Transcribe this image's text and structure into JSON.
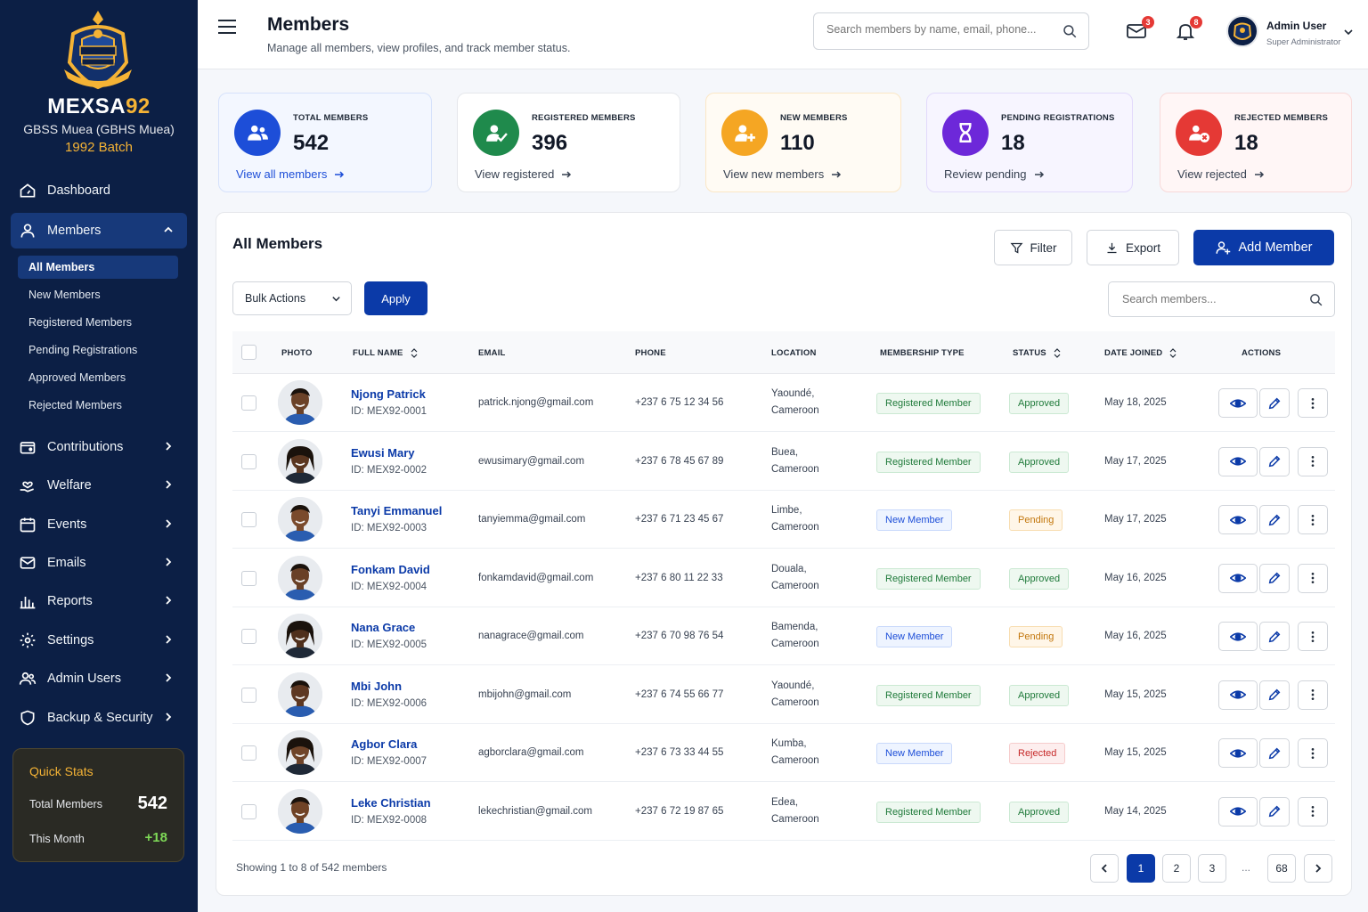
{
  "brand": {
    "name_a": "MEXSA",
    "name_b": "92",
    "school": "GBSS Muea (GBHS Muea)",
    "batch": "1992 Batch"
  },
  "nav": {
    "dashboard": "Dashboard",
    "members": "Members",
    "sub": [
      "All Members",
      "New Members",
      "Registered Members",
      "Pending Registrations",
      "Approved Members",
      "Rejected Members"
    ],
    "contributions": "Contributions",
    "welfare": "Welfare",
    "events": "Events",
    "emails": "Emails",
    "reports": "Reports",
    "settings": "Settings",
    "admin_users": "Admin Users",
    "backup": "Backup & Security"
  },
  "quick_stats": {
    "title": "Quick Stats",
    "total_label": "Total Members",
    "total_value": "542",
    "month_label": "This Month",
    "month_value": "+18"
  },
  "header": {
    "title": "Members",
    "subtitle": "Manage all members, view profiles, and track member status.",
    "search_placeholder": "Search members by name, email, phone...",
    "mail_badge": "3",
    "bell_badge": "8",
    "admin_name": "Admin User",
    "admin_role": "Super Administrator"
  },
  "stats": [
    {
      "label": "TOTAL MEMBERS",
      "value": "542",
      "link": "View all members",
      "color": "#1d4ed8",
      "bg": "#f3f7ff",
      "border": "#d6e2fb"
    },
    {
      "label": "REGISTERED MEMBERS",
      "value": "396",
      "link": "View registered",
      "color": "#1f8a4c",
      "bg": "#ffffff",
      "border": "#e5e7eb"
    },
    {
      "label": "NEW MEMBERS",
      "value": "110",
      "link": "View new members",
      "color": "#f5a623",
      "bg": "#fffbf4",
      "border": "#fbe7c6"
    },
    {
      "label": "PENDING REGISTRATIONS",
      "value": "18",
      "link": "Review pending",
      "color": "#6d28d9",
      "bg": "#f7f5ff",
      "border": "#e2dafb"
    },
    {
      "label": "REJECTED MEMBERS",
      "value": "18",
      "link": "View rejected",
      "color": "#e53935",
      "bg": "#fff6f6",
      "border": "#f8d9d9"
    }
  ],
  "panel": {
    "title": "All Members",
    "filter": "Filter",
    "export": "Export",
    "add": "Add Member",
    "bulk": "Bulk Actions",
    "apply": "Apply",
    "search_placeholder": "Search members..."
  },
  "columns": {
    "photo": "PHOTO",
    "name": "FULL NAME",
    "email": "EMAIL",
    "phone": "PHONE",
    "location": "LOCATION",
    "type": "MEMBERSHIP TYPE",
    "status": "STATUS",
    "date": "DATE JOINED",
    "actions": "ACTIONS"
  },
  "members": [
    {
      "name": "Njong Patrick",
      "id": "ID: MEX92-0001",
      "email": "patrick.njong@gmail.com",
      "phone": "+237 6 75 12 34 56",
      "city": "Yaoundé,",
      "country": "Cameroon",
      "type": "Registered Member",
      "status": "Approved",
      "date": "May 18, 2025",
      "gender": "m"
    },
    {
      "name": "Ewusi Mary",
      "id": "ID: MEX92-0002",
      "email": "ewusimary@gmail.com",
      "phone": "+237 6 78 45 67 89",
      "city": "Buea,",
      "country": "Cameroon",
      "type": "Registered Member",
      "status": "Approved",
      "date": "May 17, 2025",
      "gender": "f"
    },
    {
      "name": "Tanyi Emmanuel",
      "id": "ID: MEX92-0003",
      "email": "tanyiemma@gmail.com",
      "phone": "+237 6 71 23 45 67",
      "city": "Limbe,",
      "country": "Cameroon",
      "type": "New Member",
      "status": "Pending",
      "date": "May 17, 2025",
      "gender": "m"
    },
    {
      "name": "Fonkam David",
      "id": "ID: MEX92-0004",
      "email": "fonkamdavid@gmail.com",
      "phone": "+237 6 80 11 22 33",
      "city": "Douala,",
      "country": "Cameroon",
      "type": "Registered Member",
      "status": "Approved",
      "date": "May 16, 2025",
      "gender": "m"
    },
    {
      "name": "Nana Grace",
      "id": "ID: MEX92-0005",
      "email": "nanagrace@gmail.com",
      "phone": "+237 6 70 98 76 54",
      "city": "Bamenda,",
      "country": "Cameroon",
      "type": "New Member",
      "status": "Pending",
      "date": "May 16, 2025",
      "gender": "f"
    },
    {
      "name": "Mbi John",
      "id": "ID: MEX92-0006",
      "email": "mbijohn@gmail.com",
      "phone": "+237 6 74 55 66 77",
      "city": "Yaoundé,",
      "country": "Cameroon",
      "type": "Registered Member",
      "status": "Approved",
      "date": "May 15, 2025",
      "gender": "m"
    },
    {
      "name": "Agbor Clara",
      "id": "ID: MEX92-0007",
      "email": "agborclara@gmail.com",
      "phone": "+237 6 73 33 44 55",
      "city": "Kumba,",
      "country": "Cameroon",
      "type": "New Member",
      "status": "Rejected",
      "date": "May 15, 2025",
      "gender": "f"
    },
    {
      "name": "Leke Christian",
      "id": "ID: MEX92-0008",
      "email": "lekechristian@gmail.com",
      "phone": "+237 6 72 19 87 65",
      "city": "Edea,",
      "country": "Cameroon",
      "type": "Registered Member",
      "status": "Approved",
      "date": "May 14, 2025",
      "gender": "m"
    }
  ],
  "pagination": {
    "showing": "Showing 1 to 8 of 542 members",
    "pages": [
      "1",
      "2",
      "3"
    ],
    "dots": "...",
    "last": "68"
  }
}
